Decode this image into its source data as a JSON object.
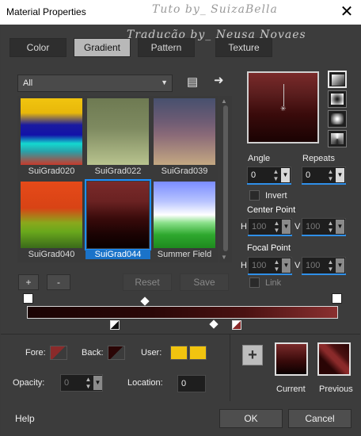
{
  "window": {
    "title": "Material Properties",
    "watermark_line1": "Tuto by_ SuizaBella",
    "watermark_line2": "Tradução by_ Neusa Novaes"
  },
  "tabs": [
    {
      "label": "Color",
      "active": false
    },
    {
      "label": "Gradient",
      "active": true
    },
    {
      "label": "Pattern",
      "active": false
    },
    {
      "label": "Texture",
      "active": false
    }
  ],
  "category_dropdown": {
    "value": "All"
  },
  "gallery": {
    "items": [
      {
        "name": "SuiGrad020",
        "selected": false,
        "colors": [
          "#f1c40f",
          "#1a1aa0",
          "#14d8d0",
          "#c83a2a"
        ]
      },
      {
        "name": "SuiGrad022",
        "selected": false,
        "colors": [
          "#6e7a52",
          "#8c9a6e",
          "#b8c38e"
        ]
      },
      {
        "name": "SuiGrad039",
        "selected": false,
        "colors": [
          "#47506e",
          "#8a6a78",
          "#c4a882"
        ]
      },
      {
        "name": "SuiGrad040",
        "selected": false,
        "colors": [
          "#e64a19",
          "#d84315",
          "#6aa81c",
          "#4a7a1a"
        ]
      },
      {
        "name": "SuiGrad044",
        "selected": true,
        "colors": [
          "#7a2a2a",
          "#3a0b0b",
          "#0a0000"
        ]
      },
      {
        "name": "Summer Field",
        "selected": false,
        "colors": [
          "#7a8cff",
          "#ffffff",
          "#2ea82e"
        ]
      }
    ]
  },
  "gallery_buttons": {
    "add": "+",
    "remove": "-",
    "reset": "Reset",
    "save": "Save"
  },
  "angle": {
    "label": "Angle",
    "value": "0"
  },
  "repeats": {
    "label": "Repeats",
    "value": "0"
  },
  "invert": {
    "label": "Invert",
    "checked": false
  },
  "center_point": {
    "label": "Center Point",
    "h_label": "H",
    "h_value": "100",
    "v_label": "V",
    "v_value": "100"
  },
  "focal_point": {
    "label": "Focal Point",
    "h_label": "H",
    "h_value": "100",
    "v_label": "V",
    "v_value": "100"
  },
  "link": {
    "label": "Link",
    "checked": false
  },
  "stops": {
    "fore_label": "Fore:",
    "fore_color": "#8a2a2a",
    "back_label": "Back:",
    "back_color": "#2a0505",
    "user_label": "User:",
    "user_colors": [
      "#f1c40f",
      "#f1c40f"
    ],
    "opacity_label": "Opacity:",
    "opacity_value": "0",
    "location_label": "Location:",
    "location_value": "0"
  },
  "current_label": "Current",
  "previous_label": "Previous",
  "footer": {
    "help": "Help",
    "ok": "OK",
    "cancel": "Cancel"
  },
  "icons": {
    "close": "close-icon",
    "style_linear": "linear-gradient-icon",
    "style_rect": "rectangular-gradient-icon",
    "style_sunburst": "sunburst-gradient-icon",
    "style_radial": "radial-gradient-icon"
  }
}
